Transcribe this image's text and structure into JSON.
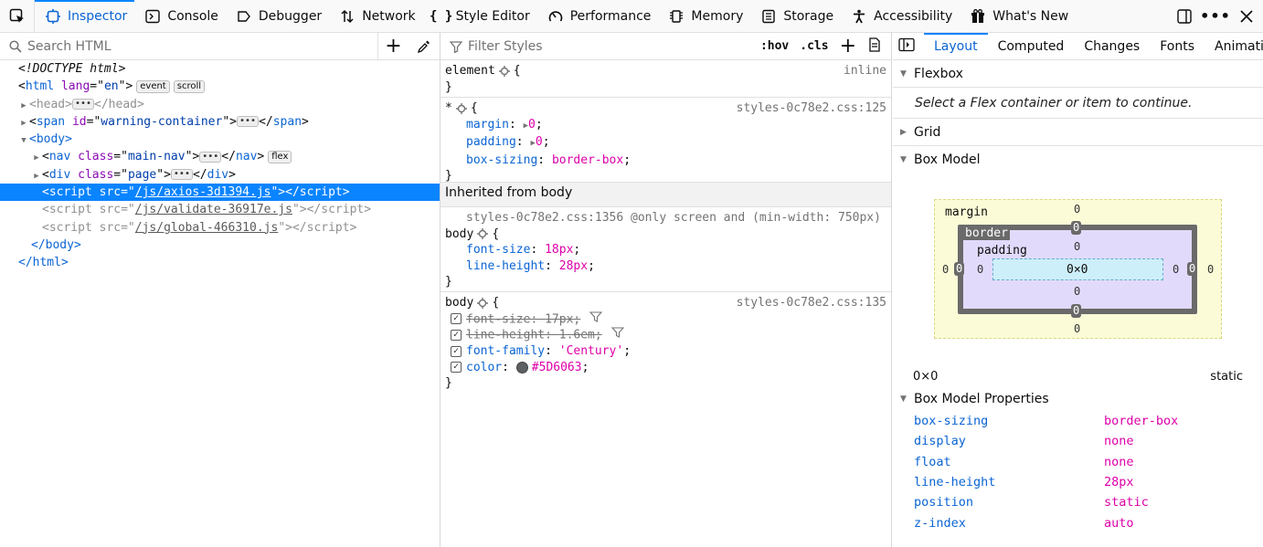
{
  "toolbar": {
    "tabs": [
      {
        "label": "Inspector",
        "icon": "inspector-icon",
        "selected": true
      },
      {
        "label": "Console",
        "icon": "console-icon"
      },
      {
        "label": "Debugger",
        "icon": "debugger-icon"
      },
      {
        "label": "Network",
        "icon": "network-icon"
      },
      {
        "label": "Style Editor",
        "icon": "style-editor-icon"
      },
      {
        "label": "Performance",
        "icon": "performance-icon"
      },
      {
        "label": "Memory",
        "icon": "memory-icon"
      },
      {
        "label": "Storage",
        "icon": "storage-icon"
      },
      {
        "label": "Accessibility",
        "icon": "accessibility-icon"
      },
      {
        "label": "What's New",
        "icon": "gift-icon"
      }
    ]
  },
  "markup": {
    "search_placeholder": "Search HTML",
    "doctype": "<!DOCTYPE html>",
    "html_open": {
      "tag": "html",
      "attr": "lang",
      "val": "en",
      "badges": [
        "event",
        "scroll"
      ]
    },
    "head": {
      "open": "<head>",
      "close": "</head>"
    },
    "span": {
      "tag": "span",
      "attr": "id",
      "val": "warning-container"
    },
    "body_open": "<body>",
    "nav": {
      "tag": "nav",
      "attr": "class",
      "val": "main-nav",
      "badge": "flex"
    },
    "div": {
      "tag": "div",
      "attr": "class",
      "val": "page"
    },
    "scripts": [
      {
        "src": "/js/axios-3d1394.js",
        "selected": true
      },
      {
        "src": "/js/validate-36917e.js"
      },
      {
        "src": "/js/global-466310.js"
      }
    ],
    "body_close": "</body>",
    "html_close": "</html>"
  },
  "rules": {
    "filter_placeholder": "Filter Styles",
    "hov": ":hov",
    "cls": ".cls",
    "element": {
      "selector": "element",
      "source": "inline"
    },
    "universal": {
      "selector": "*",
      "source": "styles-0c78e2.css:125",
      "props": [
        {
          "name": "margin",
          "value": "0"
        },
        {
          "name": "padding",
          "value": "0"
        },
        {
          "name": "box-sizing",
          "value": "border-box"
        }
      ]
    },
    "inherited_label": "Inherited from body",
    "media_rule": {
      "source": "styles-0c78e2.css:1356 @only screen and (min-width: 750px)",
      "selector": "body",
      "props": [
        {
          "name": "font-size",
          "value": "18px"
        },
        {
          "name": "line-height",
          "value": "28px"
        }
      ]
    },
    "body_rule": {
      "selector": "body",
      "source": "styles-0c78e2.css:135",
      "props": [
        {
          "name": "font-size",
          "value": "17px",
          "struck": true
        },
        {
          "name": "line-height",
          "value": "1.6em",
          "struck": true
        },
        {
          "name": "font-family",
          "value": "'Century'"
        },
        {
          "name": "color",
          "value": "#5D6063"
        }
      ]
    }
  },
  "side": {
    "tabs": [
      "Layout",
      "Computed",
      "Changes",
      "Fonts",
      "Animations"
    ],
    "flexbox": "Flexbox",
    "flex_note": "Select a Flex container or item to continue.",
    "grid": "Grid",
    "box_model": "Box Model",
    "bm_labels": {
      "margin": "margin",
      "border": "border",
      "padding": "padding",
      "content": "0×0",
      "zero": "0"
    },
    "dims": "0×0",
    "position": "static",
    "props_title": "Box Model Properties",
    "props": [
      {
        "name": "box-sizing",
        "value": "border-box"
      },
      {
        "name": "display",
        "value": "none"
      },
      {
        "name": "float",
        "value": "none"
      },
      {
        "name": "line-height",
        "value": "28px"
      },
      {
        "name": "position",
        "value": "static"
      },
      {
        "name": "z-index",
        "value": "auto"
      }
    ]
  },
  "colors": {
    "accent": "#0a84ff",
    "swatch": "#5D6063"
  }
}
